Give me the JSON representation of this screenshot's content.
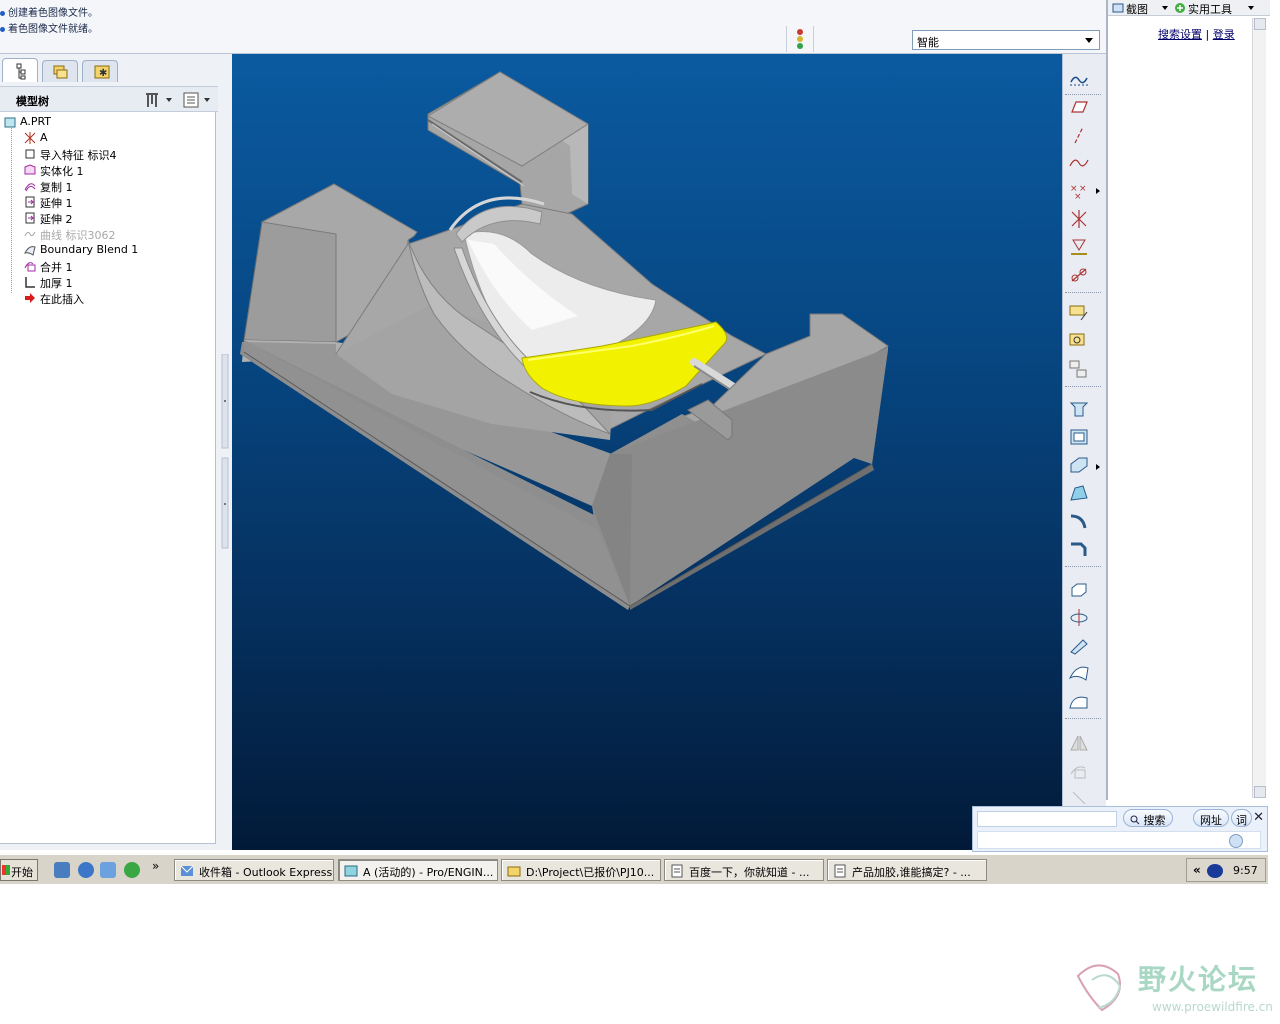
{
  "messages": [
    {
      "text": "创建着色图像文件。"
    },
    {
      "text": "着色图像文件就绪。"
    }
  ],
  "filter": {
    "value": "智能"
  },
  "left_panel": {
    "tree_title": "模型树",
    "tabs": [
      {
        "icon": "model-tree-tab-icon"
      },
      {
        "icon": "folder-browser-tab-icon"
      },
      {
        "icon": "favorites-tab-icon"
      }
    ],
    "tree_items": [
      {
        "label": "A.PRT",
        "icon": "part-icon",
        "dim": false
      },
      {
        "label": "A",
        "icon": "coordinate-system-icon",
        "dim": false
      },
      {
        "label": "导入特征 标识4",
        "icon": "import-feature-icon",
        "dim": false
      },
      {
        "label": "实体化 1",
        "icon": "solidify-icon",
        "dim": false
      },
      {
        "label": "复制 1",
        "icon": "copy-surface-icon",
        "dim": false
      },
      {
        "label": "延伸 1",
        "icon": "extend-icon",
        "dim": false
      },
      {
        "label": "延伸 2",
        "icon": "extend-icon",
        "dim": false
      },
      {
        "label": "曲线 标识3062",
        "icon": "curve-icon",
        "dim": true
      },
      {
        "label": "Boundary Blend 1",
        "icon": "boundary-blend-icon",
        "dim": false
      },
      {
        "label": "合并 1",
        "icon": "merge-icon",
        "dim": false
      },
      {
        "label": "加厚 1",
        "icon": "thicken-icon",
        "dim": false
      },
      {
        "label": "在此插入",
        "icon": "insert-here-arrow-icon",
        "dim": false
      }
    ]
  },
  "browser": {
    "tools": [
      {
        "label": "截图",
        "icon": "screenshot-icon"
      },
      {
        "label": "实用工具",
        "icon": "utility-tools-icon"
      }
    ],
    "search_settings": "搜索设置",
    "separator": "|",
    "login": "登录"
  },
  "searchbar": {
    "search_label": "搜索",
    "url_label": "网址",
    "dict_label": "词",
    "close": "✕"
  },
  "taskbar": {
    "start_label": "开始",
    "more": "»",
    "tasks": [
      {
        "label": "收件箱 - Outlook Express",
        "icon": "outlook-express-icon",
        "active": false
      },
      {
        "label": "A (活动的) - Pro/ENGIN...",
        "icon": "pro-engineer-icon",
        "active": true
      },
      {
        "label": "D:\\Project\\已报价\\PJ10...",
        "icon": "folder-icon",
        "active": false
      },
      {
        "label": "百度一下，你就知道 - ...",
        "icon": "browser-page-icon",
        "active": false
      },
      {
        "label": "产品加胶,谁能搞定? - ...",
        "icon": "browser-page-icon",
        "active": false
      }
    ],
    "tray_chevron": "«",
    "clock": "9:57"
  },
  "watermark": {
    "title": "野火论坛",
    "url": "www.proewildfire.cn"
  },
  "colors": {
    "viewport_top": "#0b5aa0",
    "viewport_bottom": "#021a38",
    "part_gray": "#a9a9a9",
    "highlight_yellow": "#f2f200"
  }
}
